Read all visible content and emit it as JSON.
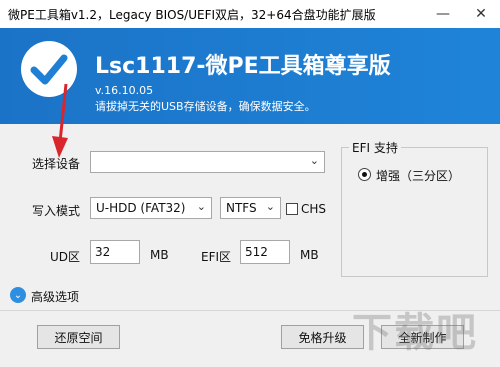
{
  "window": {
    "title": "微PE工具箱v1.2，Legacy BIOS/UEFI双启，32+64合盘功能扩展版",
    "minimize_icon": "minimize-icon",
    "close_icon": "close-icon"
  },
  "header": {
    "logo_icon": "check-logo-icon",
    "app_title": "Lsc1117-微PE工具箱尊享版",
    "version": "v.16.10.05",
    "hint": "请拔掉无关的USB存储设备，确保数据安全。"
  },
  "form": {
    "device_label": "选择设备",
    "device_value": "",
    "write_mode_label": "写入模式",
    "write_mode_value": "U-HDD (FAT32)",
    "fs_value": "NTFS",
    "chs_label": "CHS",
    "chs_checked": false,
    "ud_label": "UD区",
    "ud_value": "32",
    "ud_unit": "MB",
    "efi_label": "EFI区",
    "efi_value": "512",
    "efi_unit": "MB"
  },
  "efi_group": {
    "title": "EFI 支持",
    "option_label": "增强（三分区）",
    "selected": true
  },
  "advanced": {
    "label": "高级选项",
    "icon": "chevron-down-icon"
  },
  "buttons": {
    "restore": "还原空间",
    "upgrade": "免格升级",
    "create": "全新制作"
  },
  "colors": {
    "header": "#1f7fd4",
    "accent": "#2e8ee0",
    "annotation_arrow": "#d9262c"
  },
  "watermark": "下载吧"
}
